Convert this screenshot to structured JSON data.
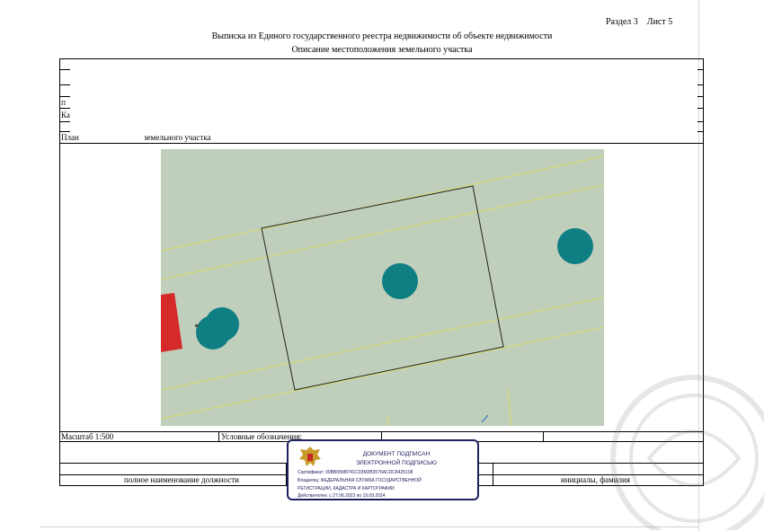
{
  "header": {
    "section_label": "Раздел 3",
    "sheet_label": "Лист 5",
    "title": "Выписка из Единого государственного реестра недвижимости об объекте недвижимости",
    "subtitle": "Описание местоположения земельного участка"
  },
  "form": {
    "plan_label": "План",
    "plan_label_tail": "земельного участка",
    "row_fragment_k": "Ка",
    "row_fragment_p": "П",
    "scale_label": "Масштаб 1:500",
    "legend_label": "Условные обозначения:",
    "position_caption": "полное наименование должности",
    "name_caption": "инициалы, фамилия"
  },
  "stamp": {
    "title_line1": "ДОКУМЕНТ ПОДПИСАН",
    "title_line2": "ЭЛЕКТРОННОЙ ПОДПИСЬЮ",
    "certificate": "Сертификат: 00BB05M8741C03M2B3576ACDC8425108",
    "owner_line1": "Владелец: ФЕДЕРАЛЬНАЯ СЛУЖБА ГОСУДАРСТВЕННОЙ",
    "owner_line2": "РЕГИСТРАЦИИ, КАДАСТРА И КАРТОГРАФИИ",
    "validity": "Действителен: с 27.06.2023 по 19.09.2024"
  },
  "colors": {
    "map_background": "#c0cfbc",
    "marker": "#0f7f84",
    "red_parcel": "#d42a2a",
    "boundary": "#222222",
    "neighbor_line": "#d9dc6a",
    "stamp_border": "#1f2160"
  }
}
